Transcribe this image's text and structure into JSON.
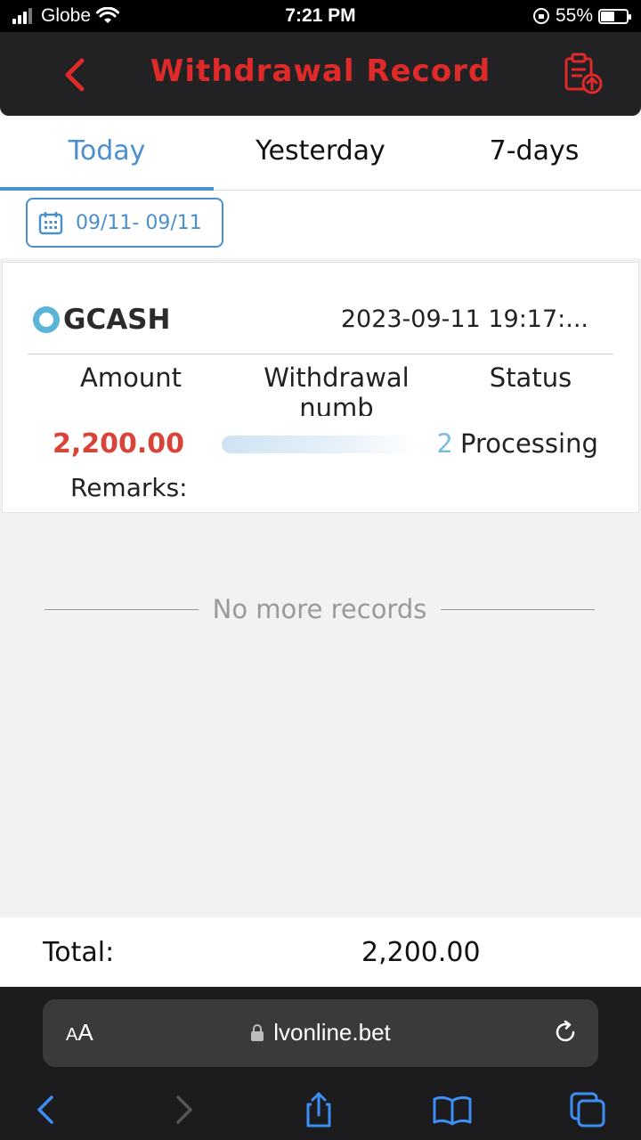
{
  "status_bar": {
    "carrier": "Globe",
    "time": "7:21 PM",
    "battery": "55%",
    "battery_level": 0.55
  },
  "header": {
    "title": "Withdrawal Record",
    "back_icon": "chevron-left-icon",
    "action_icon": "clipboard-upload-icon",
    "accent": "#e02a2a"
  },
  "tabs": [
    {
      "label": "Today",
      "active": true
    },
    {
      "label": "Yesterday",
      "active": false
    },
    {
      "label": "7-days",
      "active": false
    }
  ],
  "date_filter": {
    "label": "09/11- 09/11",
    "icon": "calendar-icon"
  },
  "record": {
    "method": "GCASH",
    "time": "2023-09-11 19:17:...",
    "columns": {
      "amount": "Amount",
      "number_line1": "Withdrawal",
      "number_line2": "numb",
      "status": "Status"
    },
    "amount": "2,200.00",
    "number_tail": "2",
    "status": "Processing",
    "remarks_label": "Remarks:"
  },
  "no_more_text": "No more records",
  "total": {
    "label": "Total:",
    "value": "2,200.00"
  },
  "browser": {
    "text_size_label_big": "A",
    "text_size_label_small": "A",
    "url": "lvonline.bet"
  },
  "colors": {
    "tab_active": "#4a8fd0",
    "amount": "#d8443a"
  }
}
